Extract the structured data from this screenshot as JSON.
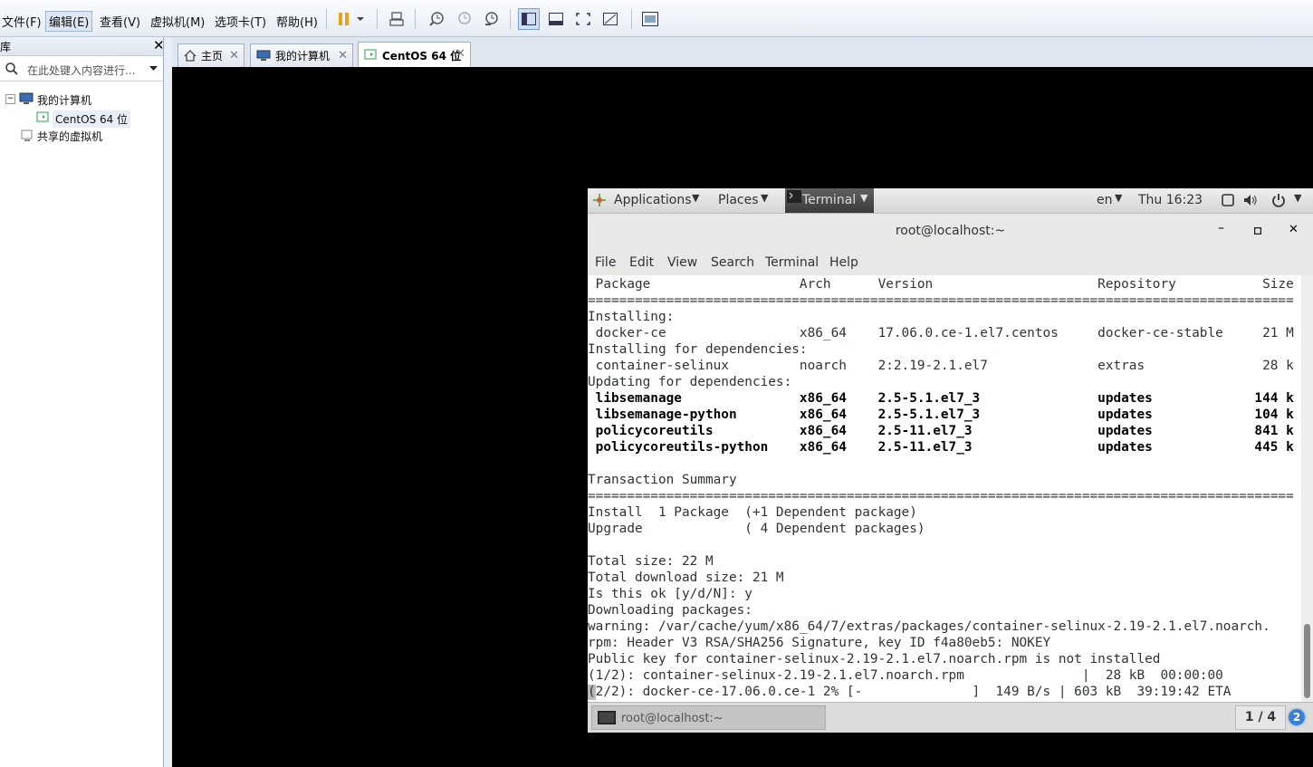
{
  "menubar": {
    "items": [
      "文件(F)",
      "编辑(E)",
      "查看(V)",
      "虚拟机(M)",
      "选项卡(T)",
      "帮助(H)"
    ]
  },
  "library": {
    "title": "库",
    "search_placeholder": "在此处键入内容进行...",
    "tree": {
      "my_computer": "我的计算机",
      "centos": "CentOS 64 位",
      "shared": "共享的虚拟机"
    }
  },
  "tabs": [
    {
      "label": "主页"
    },
    {
      "label": "我的计算机"
    },
    {
      "label": "CentOS 64 位"
    }
  ],
  "gnome": {
    "applications": "Applications",
    "places": "Places",
    "terminal": "Terminal",
    "lang": "en",
    "clock": "Thu 16:23"
  },
  "terminal": {
    "title": "root@localhost:~",
    "menu": [
      "File",
      "Edit",
      "View",
      "Search",
      "Terminal",
      "Help"
    ],
    "lines": [
      " Package                   Arch      Version                     Repository           Size",
      "==========================================================================================",
      "Installing:",
      " docker-ce                 x86_64    17.06.0.ce-1.el7.centos     docker-ce-stable     21 M",
      "Installing for dependencies:",
      " container-selinux         noarch    2:2.19-2.1.el7              extras               28 k",
      "Updating for dependencies:",
      " libsemanage               x86_64    2.5-5.1.el7_3               updates             144 k",
      " libsemanage-python        x86_64    2.5-5.1.el7_3               updates             104 k",
      " policycoreutils           x86_64    2.5-11.el7_3                updates             841 k",
      " policycoreutils-python    x86_64    2.5-11.el7_3                updates             445 k",
      "",
      "Transaction Summary",
      "==========================================================================================",
      "Install  1 Package  (+1 Dependent package)",
      "Upgrade             ( 4 Dependent packages)",
      "",
      "Total size: 22 M",
      "Total download size: 21 M",
      "Is this ok [y/d/N]: y",
      "Downloading packages:",
      "warning: /var/cache/yum/x86_64/7/extras/packages/container-selinux-2.19-2.1.el7.noarch.",
      "rpm: Header V3 RSA/SHA256 Signature, key ID f4a80eb5: NOKEY",
      "Public key for container-selinux-2.19-2.1.el7.noarch.rpm is not installed",
      "(1/2): container-selinux-2.19-2.1.el7.noarch.rpm               |  28 kB  00:00:00",
      "(2/2): docker-ce-17.06.0.ce-1 2% [-              ]  149 B/s | 603 kB  39:19:42 ETA"
    ]
  },
  "taskbar": {
    "window_label": "root@localhost:~",
    "workspace": "1 / 4",
    "notifications": "2"
  }
}
